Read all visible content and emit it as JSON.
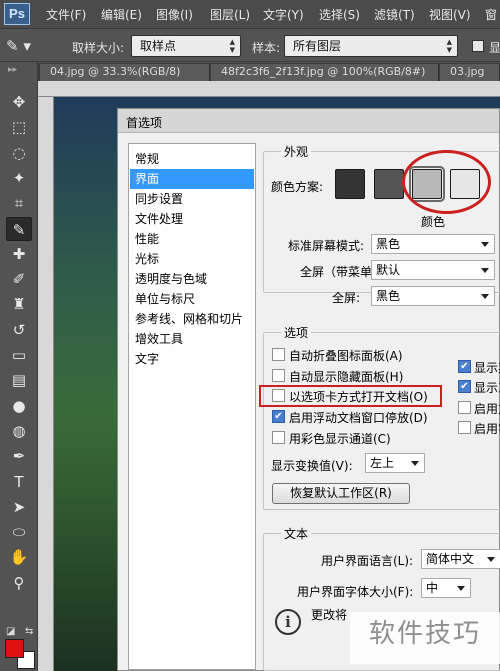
{
  "app": {
    "logo": "Ps"
  },
  "menu": [
    "文件(F)",
    "编辑(E)",
    "图像(I)",
    "图层(L)",
    "文字(Y)",
    "选择(S)",
    "滤镜(T)",
    "视图(V)",
    "窗"
  ],
  "options_bar": {
    "sample_size_label": "取样大小:",
    "sample_size_value": "取样点",
    "sample_label": "样本:",
    "sample_value": "所有图层",
    "show_ring_label": "显"
  },
  "tabs": [
    "04.jpg @ 33.3%(RGB/8)",
    "48f2c3f6_2f13f.jpg @ 100%(RGB/8#)",
    "03.jpg"
  ],
  "tools": [
    {
      "icon": "move-icon",
      "glyph": "✥"
    },
    {
      "icon": "marquee-icon",
      "glyph": "⬚"
    },
    {
      "icon": "lasso-icon",
      "glyph": "◌"
    },
    {
      "icon": "magic-wand-icon",
      "glyph": "✦"
    },
    {
      "icon": "crop-icon",
      "glyph": "⌗"
    },
    {
      "icon": "eyedropper-icon",
      "glyph": "✎",
      "active": true
    },
    {
      "icon": "healing-brush-icon",
      "glyph": "✚"
    },
    {
      "icon": "brush-icon",
      "glyph": "✐"
    },
    {
      "icon": "clone-stamp-icon",
      "glyph": "♜"
    },
    {
      "icon": "history-brush-icon",
      "glyph": "↺"
    },
    {
      "icon": "eraser-icon",
      "glyph": "▭"
    },
    {
      "icon": "gradient-icon",
      "glyph": "▤"
    },
    {
      "icon": "blur-icon",
      "glyph": "●"
    },
    {
      "icon": "dodge-icon",
      "glyph": "◍"
    },
    {
      "icon": "pen-icon",
      "glyph": "✒"
    },
    {
      "icon": "type-icon",
      "glyph": "T"
    },
    {
      "icon": "path-selection-icon",
      "glyph": "➤"
    },
    {
      "icon": "shape-icon",
      "glyph": "⬭"
    },
    {
      "icon": "hand-icon",
      "glyph": "✋"
    },
    {
      "icon": "zoom-icon",
      "glyph": "⚲"
    }
  ],
  "colors": {
    "foreground": "#e01010",
    "background": "#ffffff",
    "highlight": "#cc1f1f",
    "selection": "#3399ff"
  },
  "dialog": {
    "title": "首选项",
    "sidebar": [
      "常规",
      "界面",
      "同步设置",
      "文件处理",
      "性能",
      "光标",
      "透明度与色域",
      "单位与标尺",
      "参考线、网格和切片",
      "增效工具",
      "文字"
    ],
    "selected_index": 1,
    "appearance": {
      "group_title": "外观",
      "color_scheme_label": "颜色方案:",
      "swatches": [
        "#333333",
        "#555555",
        "#b8b8b8",
        "#e6e6e6"
      ],
      "selected_swatch_label": "颜色",
      "standard_screen_label": "标准屏幕模式:",
      "standard_screen_value": "黑色",
      "fullscreen_menu_label": "全屏（带菜单）:",
      "fullscreen_menu_value": "默认",
      "fullscreen_label": "全屏:",
      "fullscreen_value": "黑色"
    },
    "options": {
      "group_title": "选项",
      "checkboxes": [
        {
          "label": "自动折叠图标面板(A)",
          "checked": false
        },
        {
          "label": "自动显示隐藏面板(H)",
          "checked": false
        },
        {
          "label": "以选项卡方式打开文档(O)",
          "checked": false
        },
        {
          "label": "启用浮动文档窗口停放(D)",
          "checked": true
        },
        {
          "label": "用彩色显示通道(C)",
          "checked": false
        }
      ],
      "right_checkboxes": [
        {
          "label": "显示菜",
          "checked": true
        },
        {
          "label": "显示工",
          "checked": true
        },
        {
          "label": "启用文",
          "checked": false
        },
        {
          "label": "启用字",
          "checked": false
        }
      ],
      "transform_values_label": "显示变换值(V):",
      "transform_values_value": "左上",
      "restore_button": "恢复默认工作区(R)"
    },
    "text": {
      "group_title": "文本",
      "ui_language_label": "用户界面语言(L):",
      "ui_language_value": "简体中文",
      "ui_font_size_label": "用户界面字体大小(F):",
      "ui_font_size_value": "中",
      "info_text": "更改将"
    }
  },
  "watermark": "软件技巧"
}
